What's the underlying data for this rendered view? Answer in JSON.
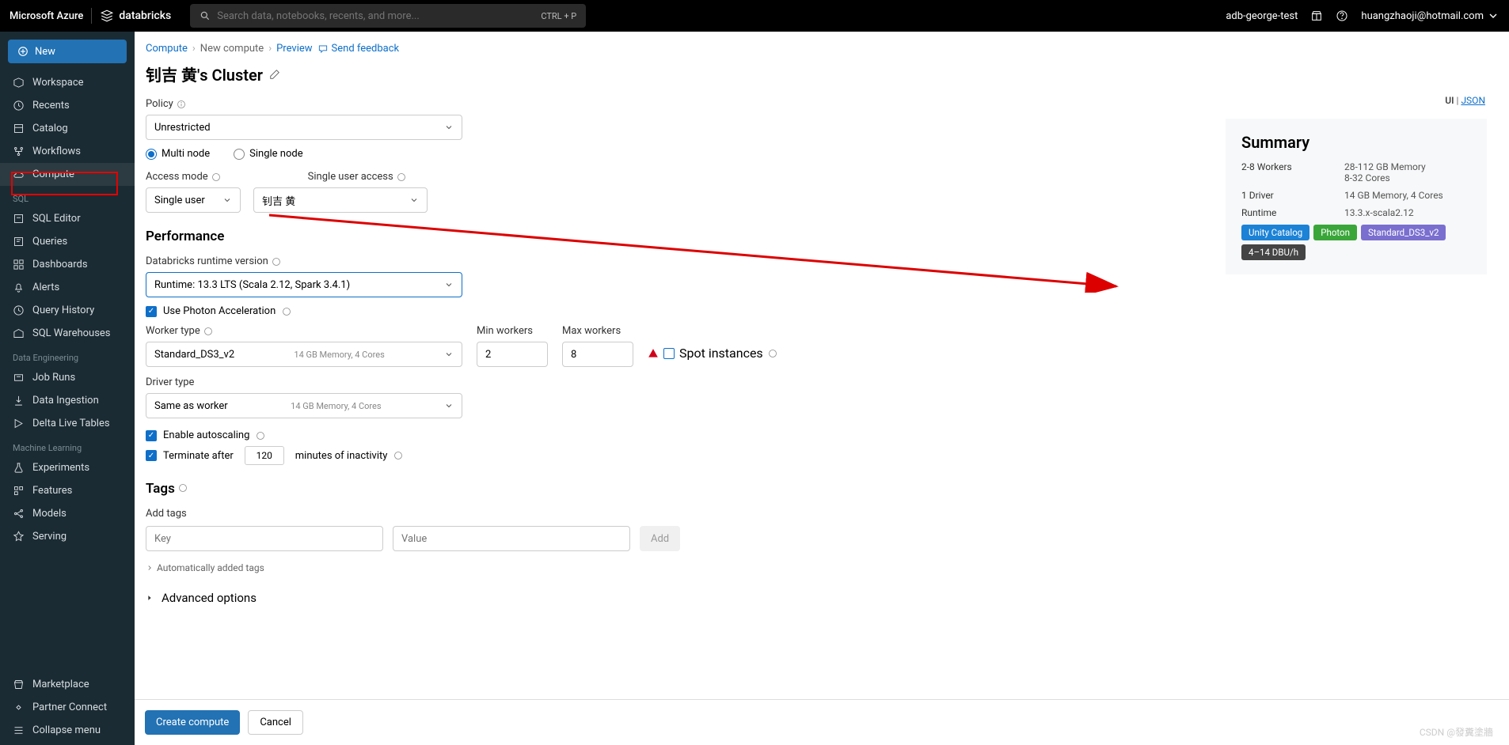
{
  "topbar": {
    "azure": "Microsoft Azure",
    "brand": "databricks",
    "search_placeholder": "Search data, notebooks, recents, and more...",
    "kbd": "CTRL + P",
    "workspace": "adb-george-test",
    "email": "huangzhaoji@hotmail.com"
  },
  "sidebar": {
    "new": "New",
    "items_top": [
      "Workspace",
      "Recents",
      "Catalog",
      "Workflows",
      "Compute"
    ],
    "sql_label": "SQL",
    "items_sql": [
      "SQL Editor",
      "Queries",
      "Dashboards",
      "Alerts",
      "Query History",
      "SQL Warehouses"
    ],
    "de_label": "Data Engineering",
    "items_de": [
      "Job Runs",
      "Data Ingestion",
      "Delta Live Tables"
    ],
    "ml_label": "Machine Learning",
    "items_ml": [
      "Experiments",
      "Features",
      "Models",
      "Serving"
    ],
    "bottom": [
      "Marketplace",
      "Partner Connect",
      "Collapse menu"
    ]
  },
  "breadcrumbs": {
    "compute": "Compute",
    "new": "New compute",
    "preview": "Preview",
    "feedback": "Send feedback"
  },
  "cluster_title": "钊吉 黄's Cluster",
  "ui_json": {
    "ui": "UI",
    "json": "JSON"
  },
  "policy": {
    "label": "Policy",
    "value": "Unrestricted"
  },
  "node_mode": {
    "multi": "Multi node",
    "single": "Single node"
  },
  "access": {
    "mode_label": "Access mode",
    "single_user_label": "Single user access",
    "mode_value": "Single user",
    "user_value": "钊吉 黄"
  },
  "performance": {
    "title": "Performance",
    "runtime_label": "Databricks runtime version",
    "runtime_value": "Runtime: 13.3 LTS (Scala 2.12, Spark 3.4.1)",
    "photon": "Use Photon Acceleration",
    "worker_type_label": "Worker type",
    "worker_type_value": "Standard_DS3_v2",
    "worker_desc": "14 GB Memory, 4 Cores",
    "min_label": "Min workers",
    "max_label": "Max workers",
    "min_val": "2",
    "max_val": "8",
    "spot": "Spot instances",
    "driver_label": "Driver type",
    "driver_value": "Same as worker",
    "driver_desc": "14 GB Memory, 4 Cores",
    "autoscale": "Enable autoscaling",
    "terminate": "Terminate after",
    "terminate_val": "120",
    "terminate_suffix": "minutes of inactivity"
  },
  "tags": {
    "title": "Tags",
    "add_label": "Add tags",
    "key_ph": "Key",
    "value_ph": "Value",
    "add_btn": "Add",
    "auto": "Automatically added tags"
  },
  "advanced": "Advanced options",
  "actions": {
    "create": "Create compute",
    "cancel": "Cancel"
  },
  "summary": {
    "title": "Summary",
    "workers_l": "2-8 Workers",
    "workers_r1": "28-112 GB Memory",
    "workers_r2": "8-32 Cores",
    "driver_l": "1 Driver",
    "driver_r": "14 GB Memory, 4 Cores",
    "runtime_l": "Runtime",
    "runtime_r": "13.3.x-scala2.12",
    "badges": {
      "uc": "Unity Catalog",
      "photon": "Photon",
      "std": "Standard_DS3_v2",
      "dbu": "4–14 DBU/h"
    }
  },
  "watermark": "CSDN @發糞塗牆"
}
